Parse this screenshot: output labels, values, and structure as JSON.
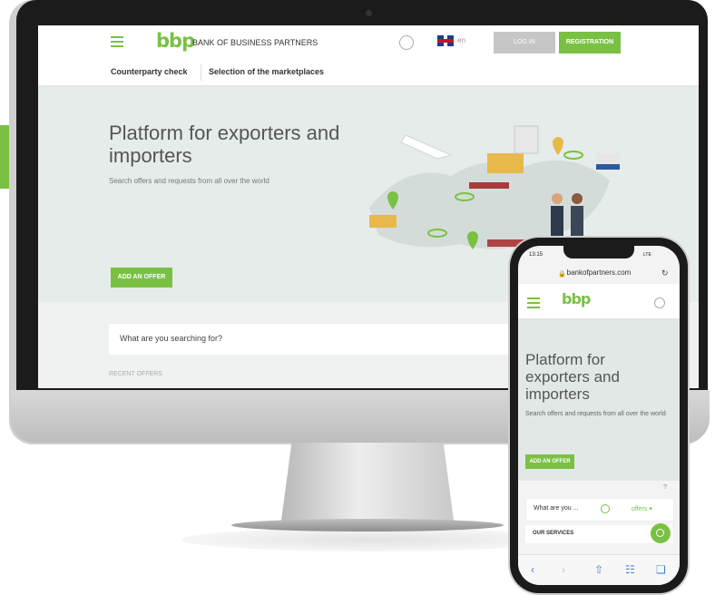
{
  "desktop": {
    "logo": "bbp",
    "logo_text": "BANK OF BUSINESS PARTNERS",
    "lang": "en",
    "login_label": "LOG IN",
    "register_label": "REGISTRATION",
    "nav": [
      "Counterparty check",
      "Selection of the marketplaces"
    ],
    "hero_title": "Platform for exporters and importers",
    "hero_sub": "Search offers and requests from all over the world",
    "add_offer_label": "ADD AN OFFER",
    "search_placeholder": "What are you searching for?",
    "recent_label": "RECENT OFFERS"
  },
  "mobile": {
    "time": "13:15",
    "carrier": "LTE",
    "url": "bankofpartners.com",
    "logo": "bbp",
    "hero_title": "Platform for exporters and importers",
    "hero_sub": "Search offers and requests from all over the world",
    "add_offer_label": "ADD AN OFFER",
    "help": "?",
    "search_placeholder": "What are you ...",
    "search_scope": "offers ▾",
    "services_label": "OUR SERVICES"
  },
  "colors": {
    "brand_green": "#7ac143",
    "login_grey": "#c6c6c6"
  }
}
